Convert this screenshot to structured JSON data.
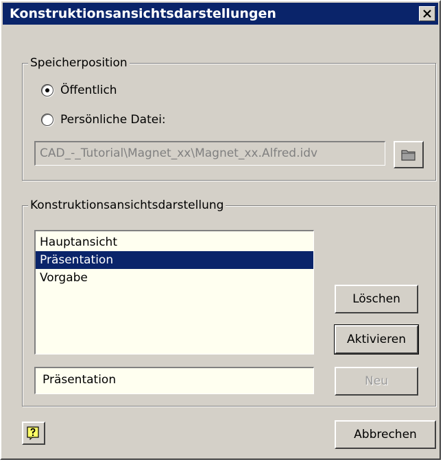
{
  "window": {
    "title": "Konstruktionsansichtsdarstellungen",
    "close_icon": "close-icon"
  },
  "storage": {
    "group_label": "Speicherposition",
    "options": [
      {
        "label": "Öffentlich",
        "selected": true
      },
      {
        "label": "Persönliche Datei:",
        "selected": false
      }
    ],
    "file_path": "CAD_-_Tutorial\\Magnet_xx\\Magnet_xx.Alfred.idv",
    "browse_icon": "folder-icon"
  },
  "representation": {
    "group_label": "Konstruktionsansichtsdarstellung",
    "items": [
      "Hauptansicht",
      "Präsentation",
      "Vorgabe"
    ],
    "selected_item": "Präsentation",
    "name_value": "Präsentation",
    "delete_label": "Löschen",
    "activate_label": "Aktivieren",
    "new_label": "Neu"
  },
  "footer": {
    "help_icon": "help-icon",
    "cancel_label": "Abbrechen"
  },
  "colors": {
    "titlebar": "#0a246a",
    "selection": "#0a246a",
    "face": "#d4d0c8",
    "list_bg": "#fffff0"
  }
}
